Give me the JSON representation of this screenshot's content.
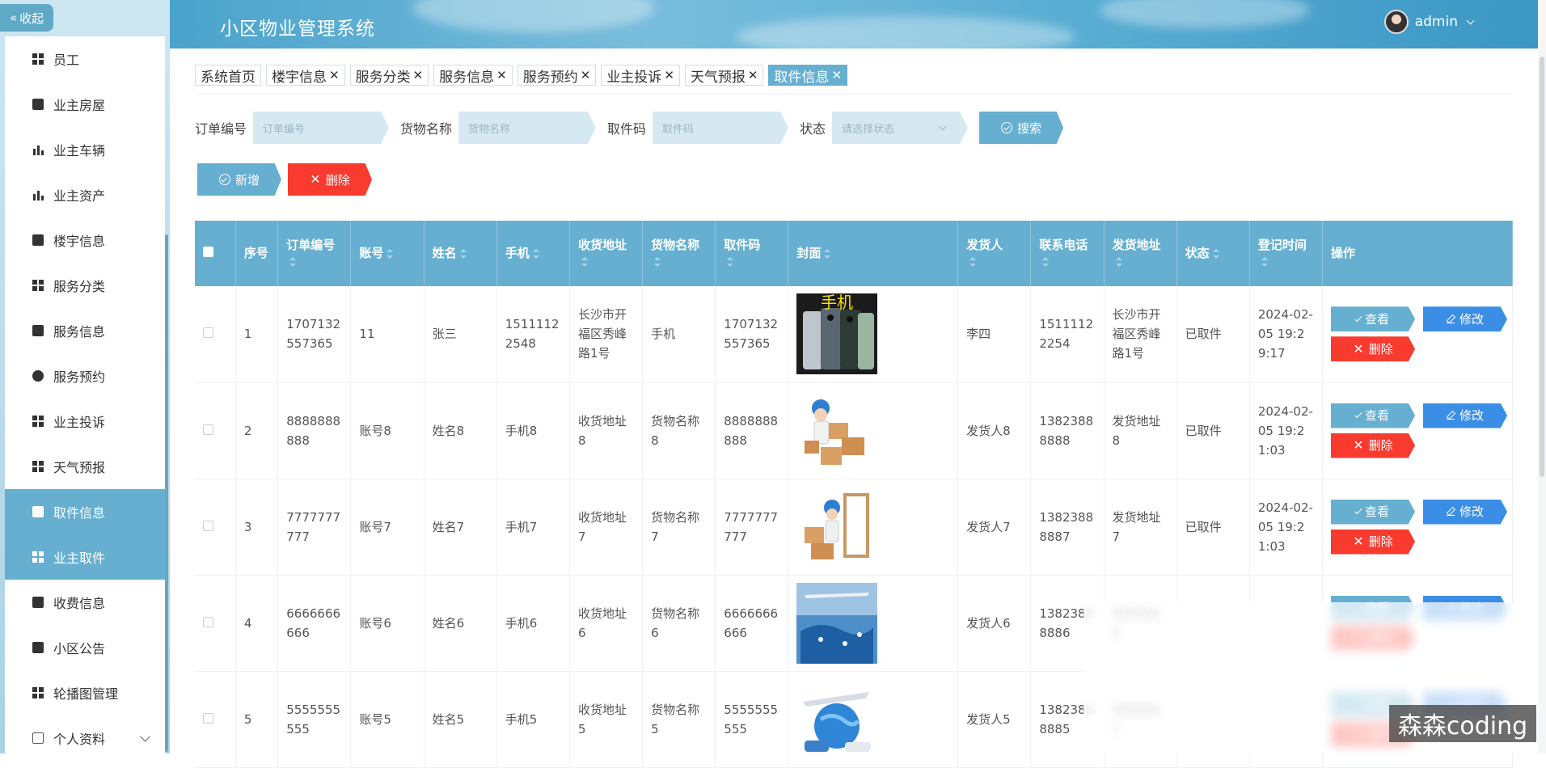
{
  "sidebar": {
    "collapse_label": "收起",
    "items": [
      {
        "label": "员工",
        "icon": "grid-icon"
      },
      {
        "label": "业主房屋",
        "icon": "chart-icon"
      },
      {
        "label": "业主车辆",
        "icon": "car-icon"
      },
      {
        "label": "业主资产",
        "icon": "bar-chart-icon"
      },
      {
        "label": "楼宇信息",
        "icon": "building-icon"
      },
      {
        "label": "服务分类",
        "icon": "grid-icon"
      },
      {
        "label": "服务信息",
        "icon": "video-icon"
      },
      {
        "label": "服务预约",
        "icon": "bulb-icon"
      },
      {
        "label": "业主投诉",
        "icon": "grid-icon"
      },
      {
        "label": "天气预报",
        "icon": "grid-icon"
      },
      {
        "label": "取件信息",
        "icon": "clipboard-icon",
        "active": true
      },
      {
        "label": "业主取件",
        "icon": "grid-icon",
        "hover": true
      },
      {
        "label": "收费信息",
        "icon": "cup-icon"
      },
      {
        "label": "小区公告",
        "icon": "notice-icon"
      },
      {
        "label": "轮播图管理",
        "icon": "grid-icon"
      },
      {
        "label": "个人资料",
        "icon": "profile-icon",
        "expandable": true
      }
    ]
  },
  "header": {
    "title": "小区物业管理系统",
    "username": "admin"
  },
  "tabs": [
    {
      "label": "系统首页",
      "closable": false
    },
    {
      "label": "楼宇信息",
      "closable": true
    },
    {
      "label": "服务分类",
      "closable": true
    },
    {
      "label": "服务信息",
      "closable": true
    },
    {
      "label": "服务预约",
      "closable": true
    },
    {
      "label": "业主投诉",
      "closable": true
    },
    {
      "label": "天气预报",
      "closable": true
    },
    {
      "label": "取件信息",
      "closable": true,
      "active": true
    }
  ],
  "search": {
    "order_label": "订单编号",
    "order_placeholder": "订单编号",
    "goods_label": "货物名称",
    "goods_placeholder": "货物名称",
    "code_label": "取件码",
    "code_placeholder": "取件码",
    "status_label": "状态",
    "status_placeholder": "请选择状态",
    "search_button": "搜索"
  },
  "actions": {
    "add_button": "新增",
    "delete_button": "删除"
  },
  "table": {
    "headers": {
      "index": "序号",
      "order_no": "订单编号",
      "account": "账号",
      "name": "姓名",
      "phone": "手机",
      "address": "收货地址",
      "goods": "货物名称",
      "code": "取件码",
      "cover": "封面",
      "sender": "发货人",
      "contact": "联系电话",
      "send_address": "发货地址",
      "status": "状态",
      "time": "登记时间",
      "ops": "操作"
    },
    "op_labels": {
      "view": "查看",
      "edit": "修改",
      "delete": "删除"
    },
    "rows": [
      {
        "index": "1",
        "order_no": "1707132557365",
        "account": "11",
        "name": "张三",
        "phone": "15111122548",
        "address": "长沙市开福区秀峰路1号",
        "goods": "手机",
        "code": "1707132557365",
        "cover": "phone-image",
        "cover_text": "手机",
        "sender": "李四",
        "contact": "15111122254",
        "send_address": "长沙市开福区秀峰路1号",
        "status": "已取件",
        "time": "2024-02-05 19:29:17"
      },
      {
        "index": "2",
        "order_no": "8888888888",
        "account": "账号8",
        "name": "姓名8",
        "phone": "手机8",
        "address": "收货地址8",
        "goods": "货物名称8",
        "code": "8888888888",
        "cover": "courier-boxes-image",
        "cover_text": "",
        "sender": "发货人8",
        "contact": "13823888888",
        "send_address": "发货地址8",
        "status": "已取件",
        "time": "2024-02-05 19:21:03"
      },
      {
        "index": "3",
        "order_no": "7777777777",
        "account": "账号7",
        "name": "姓名7",
        "phone": "手机7",
        "address": "收货地址7",
        "goods": "货物名称7",
        "code": "7777777777",
        "cover": "courier-door-image",
        "cover_text": "",
        "sender": "发货人7",
        "contact": "13823888887",
        "send_address": "发货地址7",
        "status": "已取件",
        "time": "2024-02-05 19:21:03"
      },
      {
        "index": "4",
        "order_no": "6666666666",
        "account": "账号6",
        "name": "姓名6",
        "phone": "手机6",
        "address": "收货地址6",
        "goods": "货物名称6",
        "code": "6666666666",
        "cover": "plane-map-image",
        "cover_text": "",
        "sender": "发货人6",
        "contact": "13823888886",
        "send_address": "发货地址6",
        "status": "",
        "time": ""
      },
      {
        "index": "5",
        "order_no": "5555555555",
        "account": "账号5",
        "name": "姓名5",
        "phone": "手机5",
        "address": "收货地址5",
        "goods": "货物名称5",
        "code": "5555555555",
        "cover": "globe-transport-image",
        "cover_text": "",
        "sender": "发货人5",
        "contact": "13823888885",
        "send_address": "发货地址5",
        "status": "",
        "time": ""
      }
    ]
  },
  "watermark": "森森coding",
  "colors": {
    "primary": "#66afd1",
    "danger": "#f83a2f",
    "edit": "#3a8ee6"
  }
}
